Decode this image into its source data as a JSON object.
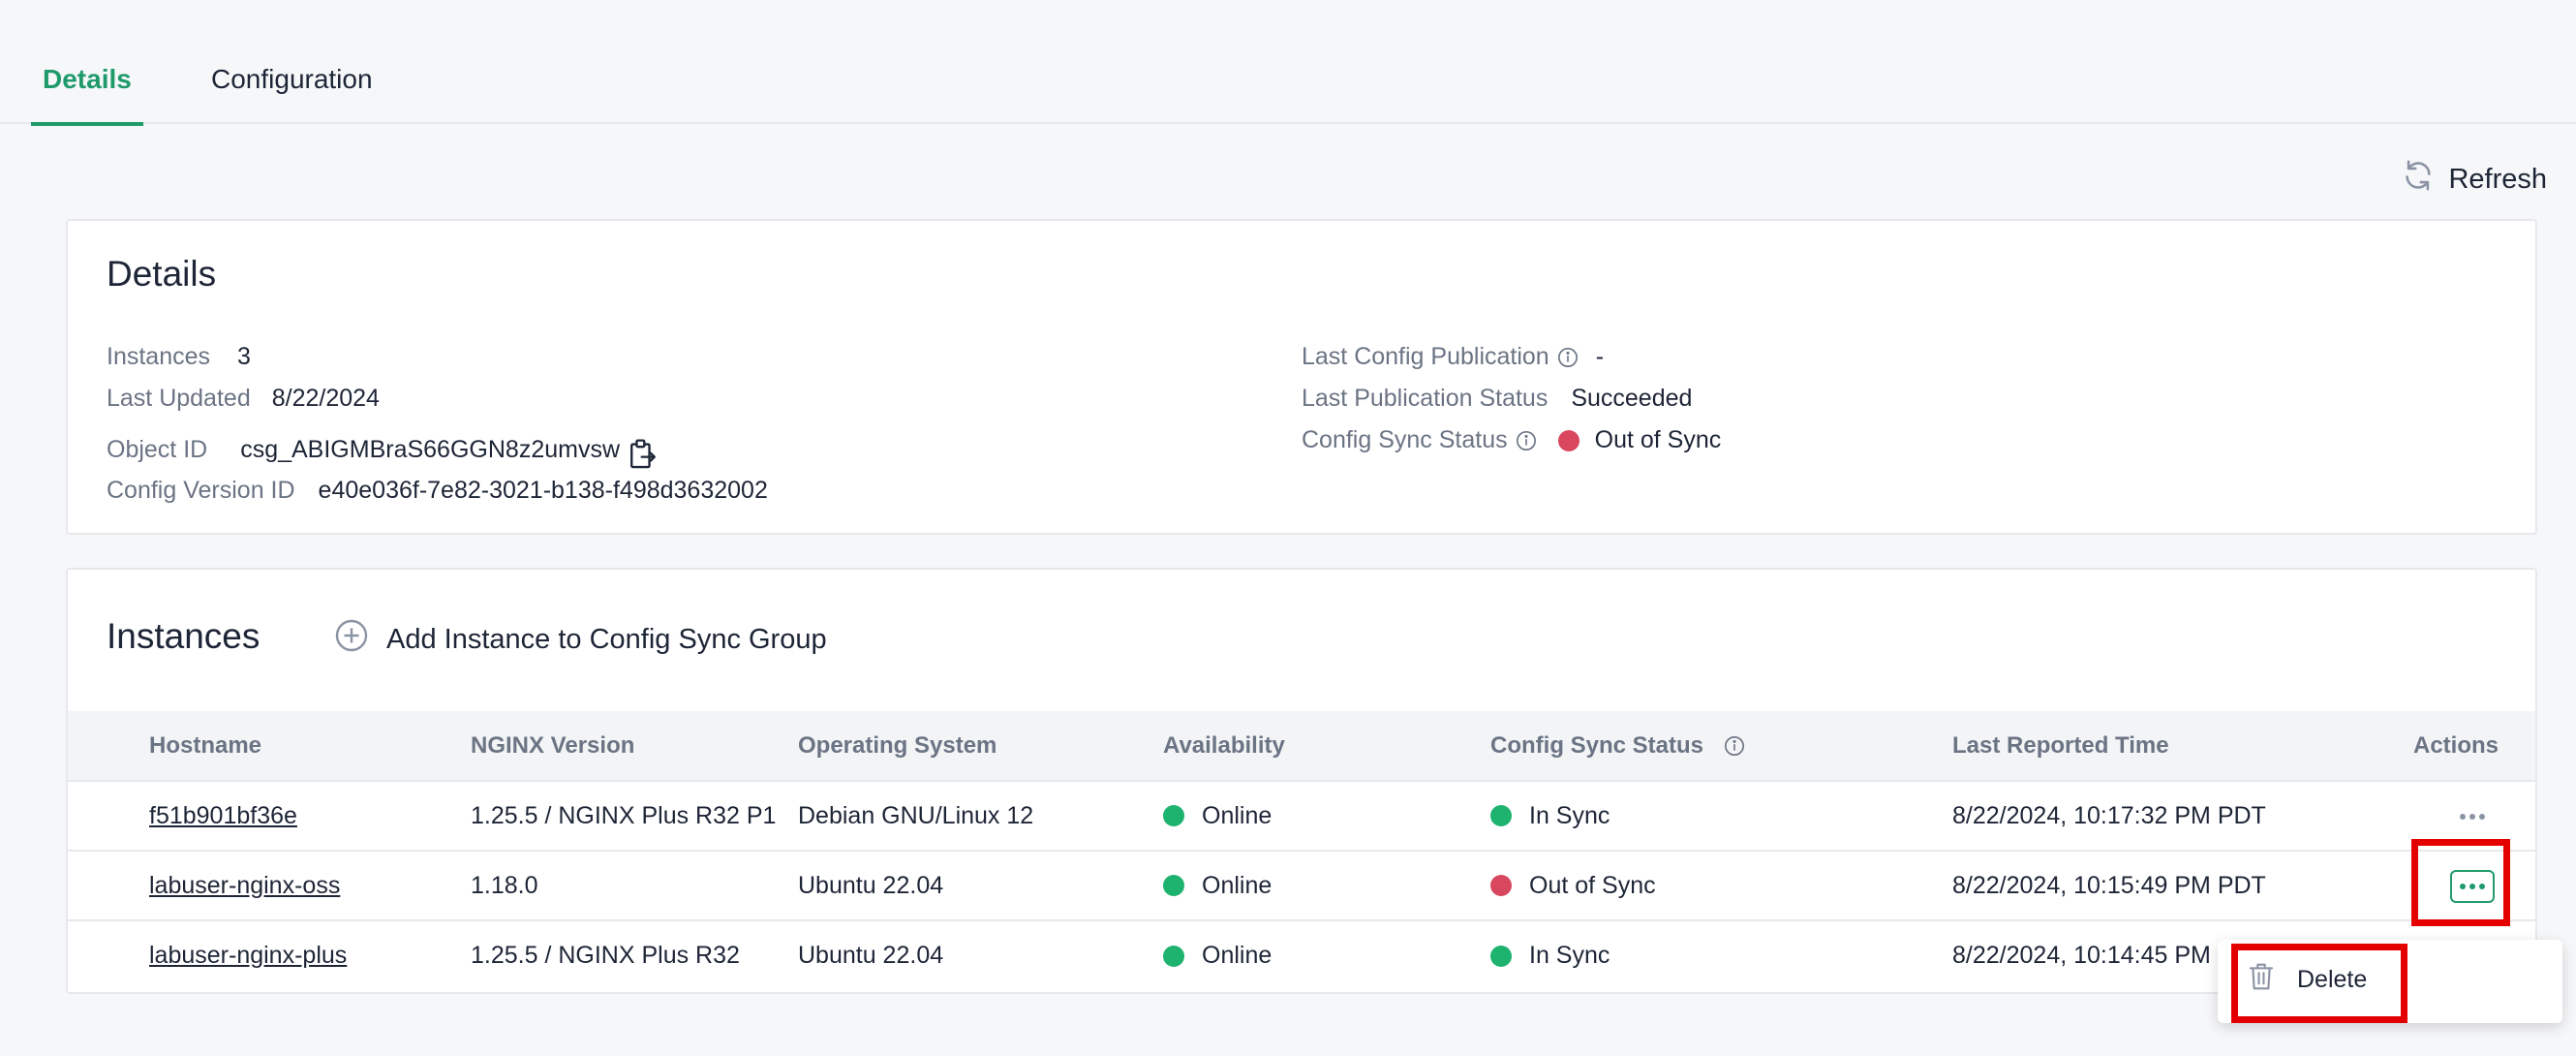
{
  "tabs": [
    {
      "label": "Details",
      "active": true
    },
    {
      "label": "Configuration",
      "active": false
    }
  ],
  "toolbar": {
    "refresh_label": "Refresh"
  },
  "details": {
    "title": "Details",
    "instances_label": "Instances",
    "instances_value": "3",
    "last_updated_label": "Last Updated",
    "last_updated_value": "8/22/2024",
    "object_id_label": "Object ID",
    "object_id_value": "csg_ABIGMBraS66GGN8z2umvsw",
    "config_version_label": "Config Version ID",
    "config_version_value": "e40e036f-7e82-3021-b138-f498d3632002",
    "last_config_pub_label": "Last Config Publication",
    "last_config_pub_value": "-",
    "last_pub_status_label": "Last Publication Status",
    "last_pub_status_value": "Succeeded",
    "config_sync_status_label": "Config Sync Status",
    "config_sync_status_value": "Out of Sync"
  },
  "instances": {
    "title": "Instances",
    "add_label": "Add Instance to Config Sync Group",
    "columns": [
      "Hostname",
      "NGINX Version",
      "Operating System",
      "Availability",
      "Config Sync Status",
      "Last Reported Time",
      "Actions"
    ],
    "rows": [
      {
        "hostname": "f51b901bf36e",
        "nginx": "1.25.5 / NGINX Plus R32 P1",
        "os": "Debian GNU/Linux 12",
        "availability": "Online",
        "sync": "In Sync",
        "time": "8/22/2024, 10:17:32 PM PDT"
      },
      {
        "hostname": "labuser-nginx-oss",
        "nginx": "1.18.0",
        "os": "Ubuntu 22.04",
        "availability": "Online",
        "sync": "Out of Sync",
        "time": "8/22/2024, 10:15:49 PM PDT"
      },
      {
        "hostname": "labuser-nginx-plus",
        "nginx": "1.25.5 / NGINX Plus R32",
        "os": "Ubuntu 22.04",
        "availability": "Online",
        "sync": "In Sync",
        "time": "8/22/2024, 10:14:45 PM"
      }
    ]
  },
  "menu": {
    "delete_label": "Delete"
  },
  "colors": {
    "accent": "#1f9b6b",
    "status_green": "#1db36f",
    "status_red": "#d9475e",
    "highlight_box": "#e50000"
  }
}
